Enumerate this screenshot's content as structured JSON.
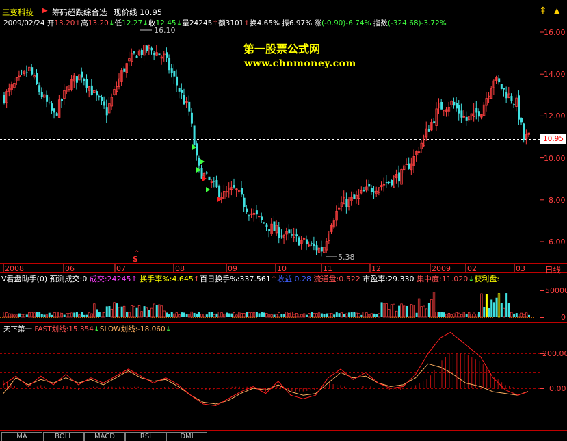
{
  "header": {
    "stock_name": "三变科技",
    "flag_icon": "flag-icon",
    "indicator_name": "筹码超跌综合选",
    "price_label": "现价线",
    "price_value": "10.95"
  },
  "quote": {
    "date": "2009/02/24",
    "open_label": "开",
    "open": "13.20",
    "high_label": "高",
    "high": "13.20",
    "low_label": "低",
    "low": "12.27",
    "close_label": "收",
    "close": "12.45",
    "volume_label": "量",
    "volume": "24245",
    "amount_label": "额",
    "amount": "3101",
    "turnover_label": "换",
    "turnover": "4.65%",
    "amplitude_label": "振",
    "amplitude": "6.97%",
    "change_label": "涨",
    "change": "(-0.90)-6.74%",
    "index_label": "指数",
    "index": "(-324.68)-3.72%"
  },
  "watermark": {
    "line1": "第一股票公式网",
    "line2": "www.chnmoney.com"
  },
  "price_axis": {
    "labels": [
      "16.00",
      "14.00",
      "12.00",
      "10.00",
      "8.00",
      "6.00"
    ],
    "current": "10.95"
  },
  "annotations": {
    "high_mark": "16.10",
    "low_mark": "5.38",
    "s_mark": "S"
  },
  "time_axis": {
    "labels": [
      "2008",
      "06",
      "07",
      "08",
      "09",
      "10",
      "11",
      "12",
      "2009",
      "02",
      "03"
    ],
    "period": "日线"
  },
  "volume_panel": {
    "title": "V看盘助手(0)",
    "forecast_label": "预测成交:0",
    "vol_label": "成交:",
    "vol": "24245",
    "turnover_label": "换手率%:",
    "turnover": "4.645",
    "hundred_label": "百日换手%:",
    "hundred": "337.561",
    "profit_label": "收益",
    "profit": "0.28",
    "float_label": "流通盘:",
    "float": "0.522",
    "pe_label": "市盈率:",
    "pe": "29.330",
    "conc_label": "集中度:",
    "conc": "11.020",
    "gain_label": "获利盘:",
    "axis_label": "50000",
    "axis_zero": "0"
  },
  "kd_panel": {
    "title": "天下第一",
    "fast_label": "FAST划线:",
    "fast": "15.354",
    "slow_label": "SLOW划线:",
    "slow": "-18.060",
    "axis_top": "200.00",
    "axis_zero": "0.00"
  },
  "tabs": [
    "MA",
    "BOLL",
    "MACD",
    "RSI",
    "DMI"
  ],
  "chart_data": {
    "type": "candlestick",
    "price_axis_range": [
      5.0,
      16.5
    ],
    "price_ticks": [
      16.0,
      14.0,
      12.0,
      10.0,
      8.0,
      6.0
    ],
    "current_price": 10.95,
    "high": 16.1,
    "low": 5.38,
    "anchors_close": [
      [
        0,
        12.9
      ],
      [
        10,
        13.6
      ],
      [
        20,
        14.2
      ],
      [
        28,
        13.2
      ],
      [
        40,
        12.0
      ],
      [
        52,
        13.5
      ],
      [
        62,
        14.0
      ],
      [
        72,
        13.0
      ],
      [
        82,
        12.2
      ],
      [
        95,
        14.2
      ],
      [
        106,
        15.0
      ],
      [
        116,
        15.2
      ],
      [
        128,
        14.8
      ],
      [
        138,
        13.5
      ],
      [
        148,
        12.2
      ],
      [
        155,
        9.5
      ],
      [
        165,
        8.8
      ],
      [
        175,
        8.2
      ],
      [
        185,
        8.5
      ],
      [
        195,
        7.5
      ],
      [
        205,
        7.0
      ],
      [
        215,
        6.6
      ],
      [
        225,
        6.3
      ],
      [
        235,
        6.1
      ],
      [
        245,
        5.8
      ],
      [
        255,
        5.6
      ],
      [
        262,
        7.0
      ],
      [
        270,
        7.8
      ],
      [
        280,
        8.0
      ],
      [
        292,
        8.5
      ],
      [
        305,
        8.8
      ],
      [
        318,
        9.2
      ],
      [
        328,
        10.0
      ],
      [
        338,
        11.2
      ],
      [
        348,
        12.4
      ],
      [
        358,
        12.6
      ],
      [
        370,
        11.8
      ],
      [
        382,
        12.3
      ],
      [
        392,
        13.8
      ],
      [
        400,
        13.2
      ],
      [
        410,
        12.6
      ],
      [
        416,
        10.9
      ],
      [
        420,
        11.0
      ]
    ],
    "volume_axis": [
      0,
      50000
    ],
    "kd_axis": [
      0,
      200
    ],
    "fast_anchors": [
      [
        0,
        20
      ],
      [
        10,
        70
      ],
      [
        20,
        10
      ],
      [
        30,
        70
      ],
      [
        40,
        20
      ],
      [
        50,
        80
      ],
      [
        60,
        20
      ],
      [
        70,
        60
      ],
      [
        80,
        30
      ],
      [
        90,
        70
      ],
      [
        100,
        110
      ],
      [
        110,
        70
      ],
      [
        120,
        30
      ],
      [
        130,
        60
      ],
      [
        140,
        20
      ],
      [
        150,
        -40
      ],
      [
        160,
        -90
      ],
      [
        170,
        -100
      ],
      [
        180,
        -60
      ],
      [
        190,
        -20
      ],
      [
        200,
        10
      ],
      [
        210,
        -30
      ],
      [
        220,
        40
      ],
      [
        230,
        -40
      ],
      [
        240,
        -60
      ],
      [
        250,
        -40
      ],
      [
        260,
        60
      ],
      [
        270,
        110
      ],
      [
        280,
        50
      ],
      [
        290,
        90
      ],
      [
        300,
        30
      ],
      [
        310,
        0
      ],
      [
        320,
        10
      ],
      [
        330,
        80
      ],
      [
        340,
        200
      ],
      [
        350,
        290
      ],
      [
        358,
        320
      ],
      [
        370,
        250
      ],
      [
        382,
        180
      ],
      [
        392,
        60
      ],
      [
        402,
        -10
      ],
      [
        412,
        -40
      ],
      [
        420,
        -20
      ]
    ],
    "slow_anchors": [
      [
        0,
        -30
      ],
      [
        10,
        60
      ],
      [
        20,
        20
      ],
      [
        30,
        50
      ],
      [
        40,
        30
      ],
      [
        50,
        60
      ],
      [
        60,
        30
      ],
      [
        70,
        50
      ],
      [
        80,
        20
      ],
      [
        90,
        60
      ],
      [
        100,
        100
      ],
      [
        110,
        60
      ],
      [
        120,
        40
      ],
      [
        130,
        50
      ],
      [
        140,
        10
      ],
      [
        150,
        -40
      ],
      [
        160,
        -80
      ],
      [
        170,
        -90
      ],
      [
        180,
        -70
      ],
      [
        190,
        -30
      ],
      [
        200,
        0
      ],
      [
        210,
        -10
      ],
      [
        220,
        20
      ],
      [
        230,
        -20
      ],
      [
        240,
        -40
      ],
      [
        250,
        -30
      ],
      [
        260,
        30
      ],
      [
        270,
        90
      ],
      [
        280,
        60
      ],
      [
        290,
        70
      ],
      [
        300,
        30
      ],
      [
        310,
        10
      ],
      [
        320,
        20
      ],
      [
        330,
        60
      ],
      [
        340,
        140
      ],
      [
        350,
        120
      ],
      [
        358,
        90
      ],
      [
        370,
        30
      ],
      [
        382,
        10
      ],
      [
        392,
        -20
      ],
      [
        402,
        -30
      ],
      [
        412,
        -40
      ],
      [
        420,
        -18
      ]
    ]
  },
  "colors": {
    "up": "#ff4040",
    "down": "#40e0e0",
    "axis": "#ff4040",
    "grid": "#a00000",
    "fast": "#ff2020",
    "slow": "#ffb060",
    "vol_high": "#ff2020",
    "vol_yellow": "#ffff00"
  }
}
